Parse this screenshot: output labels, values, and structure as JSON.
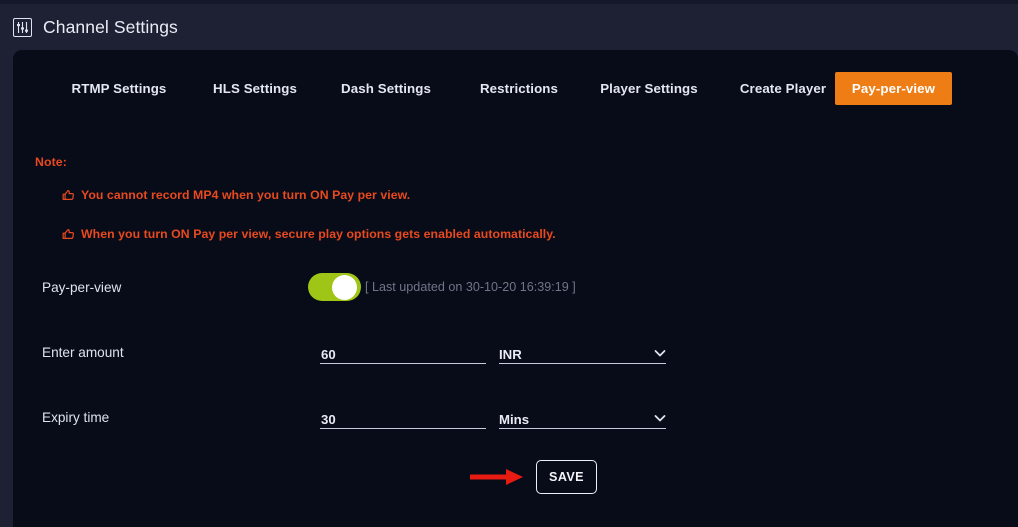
{
  "header": {
    "icon": "sliders-icon",
    "title": "Channel Settings"
  },
  "tabs": [
    {
      "label": "RTMP Settings",
      "active": false
    },
    {
      "label": "HLS Settings",
      "active": false
    },
    {
      "label": "Dash Settings",
      "active": false
    },
    {
      "label": "Restrictions",
      "active": false
    },
    {
      "label": "Player Settings",
      "active": false
    },
    {
      "label": "Create Player",
      "active": false
    },
    {
      "label": "Pay-per-view",
      "active": true
    }
  ],
  "note": {
    "title": "Note:",
    "bullet_icon": "thumbs-up-icon",
    "lines": [
      "You cannot record MP4 when you turn ON Pay per view.",
      "When you turn ON Pay per view, secure play options gets enabled automatically."
    ]
  },
  "form": {
    "payperview": {
      "label": "Pay-per-view",
      "toggle_state": "on",
      "updated_text": "[ Last updated on 30-10-20 16:39:19 ]"
    },
    "amount": {
      "label": "Enter amount",
      "value": "60",
      "currency": "INR",
      "currency_icon": "chevron-down-icon"
    },
    "expiry": {
      "label": "Expiry time",
      "value": "30",
      "unit": "Mins",
      "unit_icon": "chevron-down-icon"
    }
  },
  "actions": {
    "save_label": "SAVE",
    "annotation_icon": "red-arrow-annotation"
  },
  "colors": {
    "accent_orange": "#ef7d15",
    "note_orange": "#e8491e",
    "toggle_green": "#9fc516",
    "panel_bg": "#080b18",
    "frame_bg": "#1e2134",
    "annotation_red": "#e81b12"
  }
}
